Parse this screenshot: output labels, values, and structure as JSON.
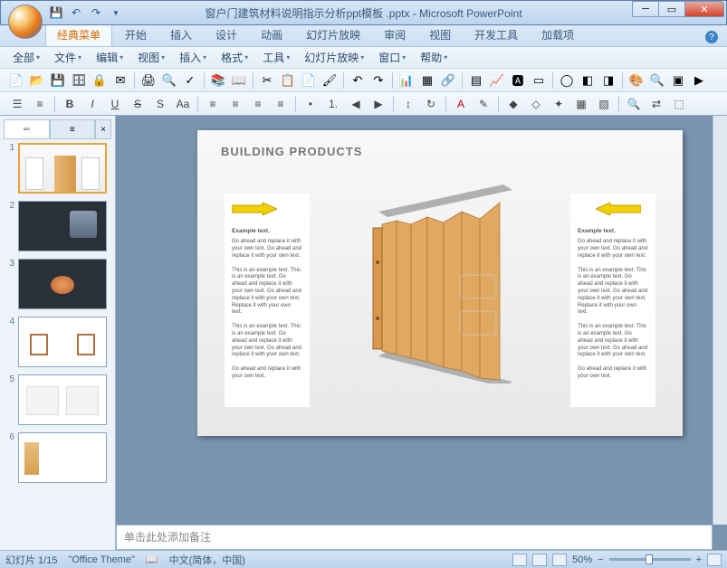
{
  "title": "窗户门建筑材料说明指示分析ppt模板 .pptx - Microsoft PowerPoint",
  "ribbon_tabs": {
    "t0": "经典菜单",
    "t1": "开始",
    "t2": "插入",
    "t3": "设计",
    "t4": "动画",
    "t5": "幻灯片放映",
    "t6": "审阅",
    "t7": "视图",
    "t8": "开发工具",
    "t9": "加载项"
  },
  "menus": {
    "m0": "全部",
    "m1": "文件",
    "m2": "编辑",
    "m3": "视图",
    "m4": "插入",
    "m5": "格式",
    "m6": "工具",
    "m7": "幻灯片放映",
    "m8": "窗口",
    "m9": "帮助"
  },
  "thumb_tabs": {
    "slides": "幻灯",
    "outline": "大纲"
  },
  "slide": {
    "title": "BUILDING PRODUCTS",
    "ex_title": "Example text.",
    "p1": "Go ahead and replace it with your own text. Go ahead and replace it with your own text.",
    "p2": "This is an example text. This is an example text. Go ahead and replace it with your own text. Go ahead and replace it with your own text. Replace it with your own text.",
    "p3": "This is an example text. This is an example text. Go ahead and replace it with your own text. Go ahead and replace it with your own text.",
    "p4": "Go ahead and replace it with your own text."
  },
  "notes_placeholder": "单击此处添加备注",
  "status": {
    "slide": "幻灯片 1/15",
    "theme": "\"Office Theme\"",
    "lang": "中文(简体，中国)",
    "zoom": "50%"
  },
  "fmt": {
    "bold": "B",
    "italic": "I",
    "underline": "U",
    "strike": "S",
    "aa": "Aa"
  }
}
